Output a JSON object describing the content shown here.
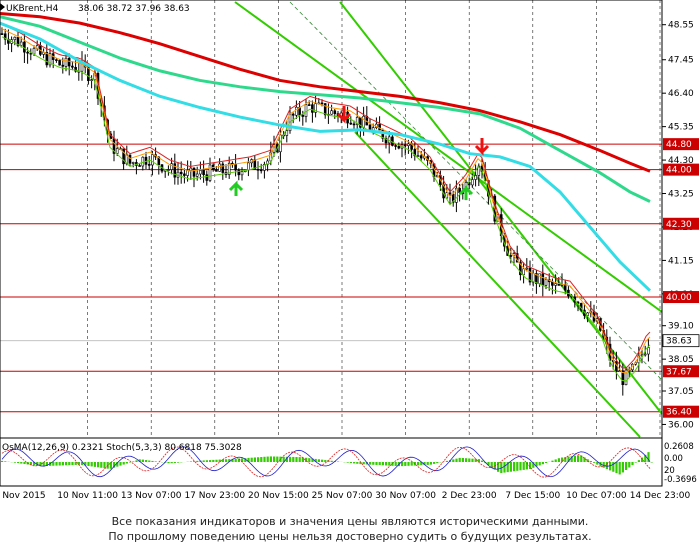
{
  "chart_data": {
    "type": "candlestick",
    "symbol_label": "UKBrent,H4",
    "ohlc_readout": [
      "38.06",
      "38.72",
      "37.96",
      "38.63"
    ],
    "price_axis": {
      "min": 35.7,
      "max": 49.2,
      "ticks": [
        "48.55",
        "47.45",
        "46.40",
        "45.35",
        "44.30",
        "43.25",
        "42.20",
        "41.15",
        "40.10",
        "39.10",
        "38.05",
        "37.05",
        "36.00"
      ]
    },
    "time_axis": {
      "labels": [
        "Nov 2015",
        "10 Nov 11:00",
        "13 Nov 07:00",
        "17 Nov 23:00",
        "20 Nov 15:00",
        "25 Nov 07:00",
        "30 Nov 07:00",
        "2 Dec 23:00",
        "7 Dec 15:00",
        "10 Dec 07:00",
        "14 Dec 23:00"
      ]
    },
    "levels": [
      {
        "value": 44.8,
        "label": "44.80",
        "color": "#cc0000"
      },
      {
        "value": 44.0,
        "label": "44.00",
        "color": "#cc0000"
      },
      {
        "value": 42.3,
        "label": "42.30",
        "color": "#cc0000"
      },
      {
        "value": 40.0,
        "label": "40.00",
        "color": "#cc0000"
      },
      {
        "value": 37.67,
        "label": "37.67",
        "color": "#cc0000"
      },
      {
        "value": 36.4,
        "label": "36.40",
        "color": "#cc0000"
      }
    ],
    "current_price": {
      "value": 38.63,
      "label": "38.63"
    },
    "moving_averages": [
      {
        "color": "#dd0000",
        "points": [
          [
            0,
            48.9
          ],
          [
            40,
            48.8
          ],
          [
            80,
            48.6
          ],
          [
            120,
            48.3
          ],
          [
            160,
            47.95
          ],
          [
            200,
            47.55
          ],
          [
            240,
            47.15
          ],
          [
            280,
            46.8
          ],
          [
            320,
            46.6
          ],
          [
            360,
            46.45
          ],
          [
            400,
            46.3
          ],
          [
            440,
            46.1
          ],
          [
            480,
            45.85
          ],
          [
            520,
            45.5
          ],
          [
            560,
            45.1
          ],
          [
            600,
            44.6
          ],
          [
            630,
            44.2
          ],
          [
            650,
            43.95
          ]
        ]
      },
      {
        "color": "#2fd98c",
        "points": [
          [
            0,
            48.8
          ],
          [
            40,
            48.5
          ],
          [
            80,
            48.0
          ],
          [
            120,
            47.5
          ],
          [
            160,
            47.1
          ],
          [
            200,
            46.8
          ],
          [
            240,
            46.6
          ],
          [
            280,
            46.45
          ],
          [
            320,
            46.35
          ],
          [
            360,
            46.25
          ],
          [
            400,
            46.1
          ],
          [
            440,
            45.95
          ],
          [
            480,
            45.75
          ],
          [
            520,
            45.3
          ],
          [
            560,
            44.6
          ],
          [
            600,
            43.9
          ],
          [
            630,
            43.3
          ],
          [
            650,
            43.0
          ]
        ]
      },
      {
        "color": "#33dde6",
        "points": [
          [
            0,
            48.6
          ],
          [
            40,
            48.1
          ],
          [
            80,
            47.4
          ],
          [
            120,
            46.8
          ],
          [
            160,
            46.3
          ],
          [
            200,
            45.95
          ],
          [
            240,
            45.65
          ],
          [
            280,
            45.4
          ],
          [
            320,
            45.2
          ],
          [
            360,
            45.25
          ],
          [
            400,
            45.1
          ],
          [
            440,
            44.8
          ],
          [
            470,
            44.5
          ],
          [
            500,
            44.4
          ],
          [
            530,
            44.1
          ],
          [
            560,
            43.3
          ],
          [
            590,
            42.2
          ],
          [
            620,
            41.1
          ],
          [
            650,
            40.2
          ]
        ]
      }
    ],
    "oscillator_label": "OsMA(12,26,9) 0.2321  Stoch(5,3,3) 80.6818 75.3028",
    "oscillator_ticks": [
      "0.2608",
      "0.00",
      "20",
      "-0.3696"
    ]
  },
  "disclaimer": {
    "line1": "Все показания индикаторов и значения цены являются историческими данными.",
    "line2": "По прошлому поведению цены нельзя достоверно судить о будущих результатах."
  }
}
